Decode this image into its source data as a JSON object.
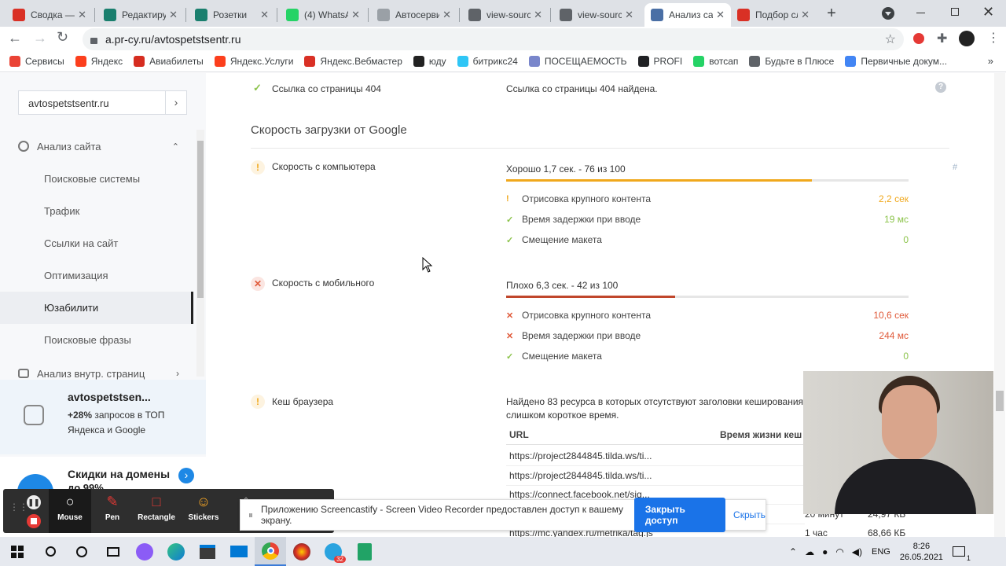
{
  "browser": {
    "tabs": [
      {
        "label": "Сводка — ",
        "icon_color": "#d93025",
        "icon": "code-icon"
      },
      {
        "label": "Редактиру",
        "icon_color": "#1a7f6e",
        "icon": "grid-icon"
      },
      {
        "label": "Розетки",
        "icon_color": "#1a7f6e",
        "icon": "grid-icon"
      },
      {
        "label": "(4) WhatsA",
        "icon_color": "#25d366",
        "icon": "whatsapp-icon"
      },
      {
        "label": "Автосерви",
        "icon_color": "#9aa0a6",
        "icon": "doc-icon"
      },
      {
        "label": "view-sourc",
        "icon_color": "#5f6368",
        "icon": "globe-icon"
      },
      {
        "label": "view-sourc",
        "icon_color": "#5f6368",
        "icon": "globe-icon"
      },
      {
        "label": "Анализ са",
        "icon_color": "#4a6fa5",
        "icon": "pr-cy-icon",
        "active": true
      },
      {
        "label": "Подбор сл",
        "icon_color": "#d93025",
        "icon": "bar-chart-icon"
      }
    ],
    "new_tab_label": "+",
    "url": "a.pr-cy.ru/avtospetstsentr.ru",
    "bookmarks": [
      {
        "label": "Сервисы",
        "color": "#ea4335"
      },
      {
        "label": "Яндекс",
        "color": "#fc3f1d"
      },
      {
        "label": "Авиабилеты",
        "color": "#d62d20"
      },
      {
        "label": "Яндекс.Услуги",
        "color": "#fc3f1d"
      },
      {
        "label": "Яндекс.Вебмастер",
        "color": "#d93025"
      },
      {
        "label": "юду",
        "color": "#222222"
      },
      {
        "label": "битрикс24",
        "color": "#2fc6f6"
      },
      {
        "label": "ПОСЕЩАЕМОСТЬ",
        "color": "#7986cb"
      },
      {
        "label": "PROFI",
        "color": "#202124"
      },
      {
        "label": "вотсап",
        "color": "#25d366"
      },
      {
        "label": "Будьте в Плюсе",
        "color": "#5f6368"
      },
      {
        "label": "Первичные докум...",
        "color": "#4285f4"
      }
    ]
  },
  "sidebar": {
    "search_value": "avtospetstsentr.ru",
    "search_go": "›",
    "section": "Анализ сайта",
    "items": [
      "Поисковые системы",
      "Трафик",
      "Ссылки на сайт",
      "Оптимизация",
      "Юзабилити",
      "Поисковые фразы"
    ],
    "active_item": "Юзабилити",
    "next_section": "Анализ внутр. страниц",
    "promo_title": "avtospetstsen...",
    "promo_bold": "+28%",
    "promo_text": " запросов в ТОП Яндекса и Google",
    "promo2_title": "Скидки на домены",
    "promo2_sub": "до 99%"
  },
  "main": {
    "row404_label": "Ссылка со страницы 404",
    "row404_value": "Ссылка со страницы 404 найдена.",
    "section_title": "Скорость загрузки от Google",
    "desktop": {
      "label": "Скорость с компьютера",
      "summary": "Хорошо 1,7 сек. - 76 из 100",
      "score": 76,
      "color": "#f0a81c",
      "metrics": [
        {
          "name": "Отрисовка крупного контента",
          "value": "2,2 сек",
          "status": "warn"
        },
        {
          "name": "Время задержки при вводе",
          "value": "19 мс",
          "status": "ok"
        },
        {
          "name": "Смещение макета",
          "value": "0",
          "status": "ok"
        }
      ]
    },
    "mobile": {
      "label": "Скорость с мобильного",
      "summary": "Плохо 6,3 сек. - 42 из 100",
      "score": 42,
      "color": "#c0462b",
      "metrics": [
        {
          "name": "Отрисовка крупного контента",
          "value": "10,6 сек",
          "status": "bad"
        },
        {
          "name": "Время задержки при вводе",
          "value": "244 мс",
          "status": "bad"
        },
        {
          "name": "Смещение макета",
          "value": "0",
          "status": "ok"
        }
      ]
    },
    "cache": {
      "label": "Кеш браузера",
      "text1": "Найдено 83 ресурса в которых отсутствуют заголовки кеширования",
      "text2": "слишком короткое время.",
      "col_url": "URL",
      "col_ttl": "Время жизни кеш",
      "rows": [
        {
          "url": "https://project2844845.tilda.ws/ti..."
        },
        {
          "url": "https://project2844845.tilda.ws/ti..."
        },
        {
          "url": "https://connect.facebook.net/sig..."
        },
        {
          "url": "",
          "ttl": "20 минут",
          "size": "24,97 КБ"
        },
        {
          "url": "https://mc.yandex.ru/metrika/tag.js",
          "ttl": "1 час",
          "size": "68,66 КБ"
        }
      ]
    },
    "help_icon": "?",
    "anchor": "#"
  },
  "screencastify": {
    "tools": [
      "Mouse",
      "Pen",
      "Rectangle",
      "Stickers",
      "E"
    ],
    "notice": "Приложению Screencastify - Screen Video Recorder предоставлен доступ к вашему экрану.",
    "stop_btn": "Закрыть доступ",
    "hide_btn": "Скрыть"
  },
  "taskbar": {
    "lang": "ENG",
    "time": "8:26",
    "date": "26.05.2021",
    "badge": "32",
    "notif_count": "1"
  },
  "colors": {
    "ok": "#8bc34a",
    "warn": "#f0a81c",
    "bad": "#e05a3a",
    "accent": "#1e88e5"
  }
}
